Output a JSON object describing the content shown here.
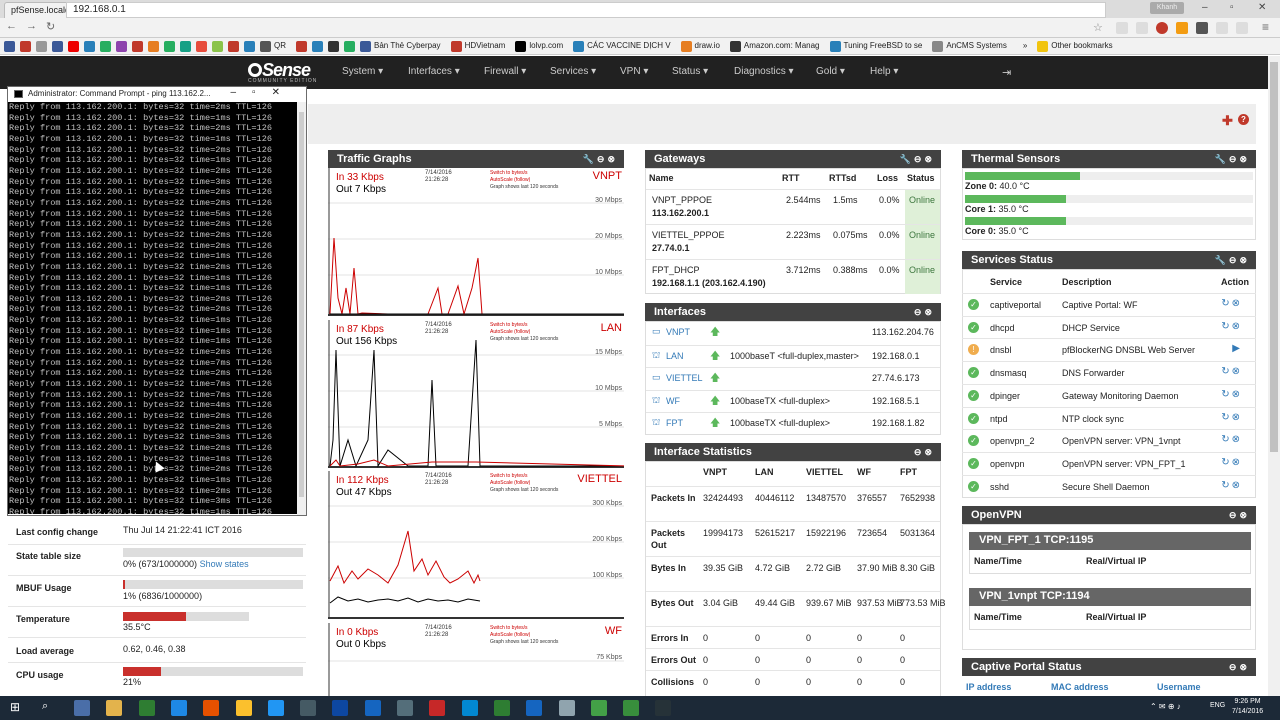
{
  "browser": {
    "tab_title": "pfSense.localdomain - Sta",
    "user": "Khanh",
    "url": "192.168.0.1",
    "bookmarks": [
      "QR",
      "Bản Thẻ Cyberpay",
      "HDVietnam",
      "lolvp.com",
      "CÁC VACCINE DỊCH V",
      "draw.io",
      "Amazon.com: Manag",
      "Tuning FreeBSD to se",
      "AnCMS Systems",
      "Other bookmarks"
    ]
  },
  "nav": {
    "logo": "Sense",
    "logo_sub": "COMMUNITY EDITION",
    "items": [
      "System ▾",
      "Interfaces ▾",
      "Firewall ▾",
      "Services ▾",
      "VPN ▾",
      "Status ▾",
      "Diagnostics ▾",
      "Gold ▾",
      "Help ▾"
    ]
  },
  "cmd": {
    "title": "Administrator: Command Prompt - ping  113.162.2...",
    "times": [
      "2",
      "1",
      "2",
      "1",
      "2",
      "1",
      "2",
      "3",
      "2",
      "2",
      "5",
      "2",
      "2",
      "2",
      "1",
      "2",
      "1",
      "1",
      "2",
      "2",
      "1",
      "1",
      "1",
      "2",
      "7",
      "2",
      "7",
      "7",
      "4",
      "2",
      "2",
      "3",
      "2",
      "1",
      "2",
      "1",
      "2",
      "3",
      "1",
      "1",
      "1",
      "2",
      "3",
      "1",
      "2",
      "2",
      "3",
      "1",
      "2"
    ]
  },
  "system_info": {
    "last_config_label": "Last config change",
    "last_config_value": "Thu Jul 14 21:22:41 ICT 2016",
    "state_label": "State table size",
    "state_value": "0% (673/1000000)",
    "show_states": "Show states",
    "mbuf_label": "MBUF Usage",
    "mbuf_value": "1% (6836/1000000)",
    "temp_label": "Temperature",
    "temp_value": "35.5°C",
    "temp_pct": 0.5,
    "load_label": "Load average",
    "load_value": "0.62, 0.46, 0.38",
    "cpu_label": "CPU usage",
    "cpu_value": "21%",
    "cpu_pct": 0.21
  },
  "traffic": {
    "title": "Traffic Graphs",
    "switch1": "Switch to bytes/s",
    "switch2": "AutoScale (follow)",
    "switch3": "Graph shows last 120 seconds",
    "graphs": [
      {
        "name": "VNPT",
        "in": "In",
        "in_val": "33 Kbps",
        "out": "Out",
        "out_val": "7 Kbps",
        "date": "7/14/2016",
        "time": "21:26:28",
        "y": [
          "30 Mbps",
          "20 Mbps",
          "10 Mbps"
        ]
      },
      {
        "name": "LAN",
        "in": "In",
        "in_val": "87 Kbps",
        "out": "Out",
        "out_val": "156 Kbps",
        "date": "7/14/2016",
        "time": "21:26:28",
        "y": [
          "15 Mbps",
          "10 Mbps",
          "5 Mbps"
        ]
      },
      {
        "name": "VIETTEL",
        "in": "In",
        "in_val": "112 Kbps",
        "out": "Out",
        "out_val": "47 Kbps",
        "date": "7/14/2016",
        "time": "21:26:28",
        "y": [
          "300 Kbps",
          "200 Kbps",
          "100 Kbps"
        ]
      },
      {
        "name": "WF",
        "in": "In",
        "in_val": "0 Kbps",
        "out": "Out",
        "out_val": "0 Kbps",
        "date": "7/14/2016",
        "time": "21:26:28",
        "y": [
          "75 Kbps"
        ]
      }
    ]
  },
  "gateways": {
    "title": "Gateways",
    "cols": [
      "Name",
      "RTT",
      "RTTsd",
      "Loss",
      "Status"
    ],
    "rows": [
      {
        "name": "VNPT_PPPOE",
        "ip": "113.162.200.1",
        "rtt": "2.544ms",
        "rttsd": "1.5ms",
        "loss": "0.0%",
        "status": "Online"
      },
      {
        "name": "VIETTEL_PPPOE",
        "ip": "27.74.0.1",
        "rtt": "2.223ms",
        "rttsd": "0.075ms",
        "loss": "0.0%",
        "status": "Online"
      },
      {
        "name": "FPT_DHCP",
        "ip": "192.168.1.1 (203.162.4.190)",
        "rtt": "3.712ms",
        "rttsd": "0.388ms",
        "loss": "0.0%",
        "status": "Online"
      }
    ]
  },
  "interfaces": {
    "title": "Interfaces",
    "rows": [
      {
        "name": "VNPT",
        "media": "",
        "ip": "113.162.204.76"
      },
      {
        "name": "LAN",
        "media": "1000baseT <full-duplex,master>",
        "ip": "192.168.0.1"
      },
      {
        "name": "VIETTEL",
        "media": "",
        "ip": "27.74.6.173"
      },
      {
        "name": "WF",
        "media": "100baseTX <full-duplex>",
        "ip": "192.168.5.1"
      },
      {
        "name": "FPT",
        "media": "100baseTX <full-duplex>",
        "ip": "192.168.1.82"
      }
    ]
  },
  "if_stats": {
    "title": "Interface Statistics",
    "cols": [
      "VNPT",
      "LAN",
      "VIETTEL",
      "WF",
      "FPT"
    ],
    "rows": [
      {
        "label": "Packets In",
        "v": [
          "32424493",
          "40446112",
          "13487570",
          "376557",
          "7652938"
        ]
      },
      {
        "label": "Packets Out",
        "v": [
          "19994173",
          "52615217",
          "15922196",
          "723654",
          "5031364"
        ]
      },
      {
        "label": "Bytes In",
        "v": [
          "39.35 GiB",
          "4.72 GiB",
          "2.72 GiB",
          "37.90 MiB",
          "8.30 GiB"
        ]
      },
      {
        "label": "Bytes Out",
        "v": [
          "3.04 GiB",
          "49.44 GiB",
          "939.67 MiB",
          "937.53 MiB",
          "773.53 MiB"
        ]
      },
      {
        "label": "Errors In",
        "v": [
          "0",
          "0",
          "0",
          "0",
          "0"
        ]
      },
      {
        "label": "Errors Out",
        "v": [
          "0",
          "0",
          "0",
          "0",
          "0"
        ]
      },
      {
        "label": "Collisions",
        "v": [
          "0",
          "0",
          "0",
          "0",
          "0"
        ]
      }
    ]
  },
  "thermal": {
    "title": "Thermal Sensors",
    "rows": [
      {
        "label": "Zone 0:",
        "value": "40.0 °C",
        "pct": 0.4
      },
      {
        "label": "Core 1:",
        "value": "35.0 °C",
        "pct": 0.35
      },
      {
        "label": "Core 0:",
        "value": "35.0 °C",
        "pct": 0.35
      }
    ]
  },
  "services": {
    "title": "Services Status",
    "cols": [
      "Service",
      "Description",
      "Action"
    ],
    "rows": [
      {
        "name": "captiveportal",
        "desc": "Captive Portal: WF",
        "running": true
      },
      {
        "name": "dhcpd",
        "desc": "DHCP Service",
        "running": true
      },
      {
        "name": "dnsbl",
        "desc": "pfBlockerNG DNSBL Web Server",
        "running": false
      },
      {
        "name": "dnsmasq",
        "desc": "DNS Forwarder",
        "running": true
      },
      {
        "name": "dpinger",
        "desc": "Gateway Monitoring Daemon",
        "running": true
      },
      {
        "name": "ntpd",
        "desc": "NTP clock sync",
        "running": true
      },
      {
        "name": "openvpn_2",
        "desc": "OpenVPN server: VPN_1vnpt",
        "running": true
      },
      {
        "name": "openvpn",
        "desc": "OpenVPN server: VPN_FPT_1",
        "running": true
      },
      {
        "name": "sshd",
        "desc": "Secure Shell Daemon",
        "running": true
      }
    ]
  },
  "openvpn": {
    "title": "OpenVPN",
    "servers": [
      {
        "name": "VPN_FPT_1 TCP:1195",
        "c1": "Name/Time",
        "c2": "Real/Virtual IP"
      },
      {
        "name": "VPN_1vnpt TCP:1194",
        "c1": "Name/Time",
        "c2": "Real/Virtual IP"
      }
    ]
  },
  "captive": {
    "title": "Captive Portal Status",
    "cols": [
      "IP address",
      "MAC address",
      "Username"
    ]
  },
  "taskbar": {
    "lang": "ENG",
    "time": "9:26 PM",
    "date": "7/14/2016"
  }
}
